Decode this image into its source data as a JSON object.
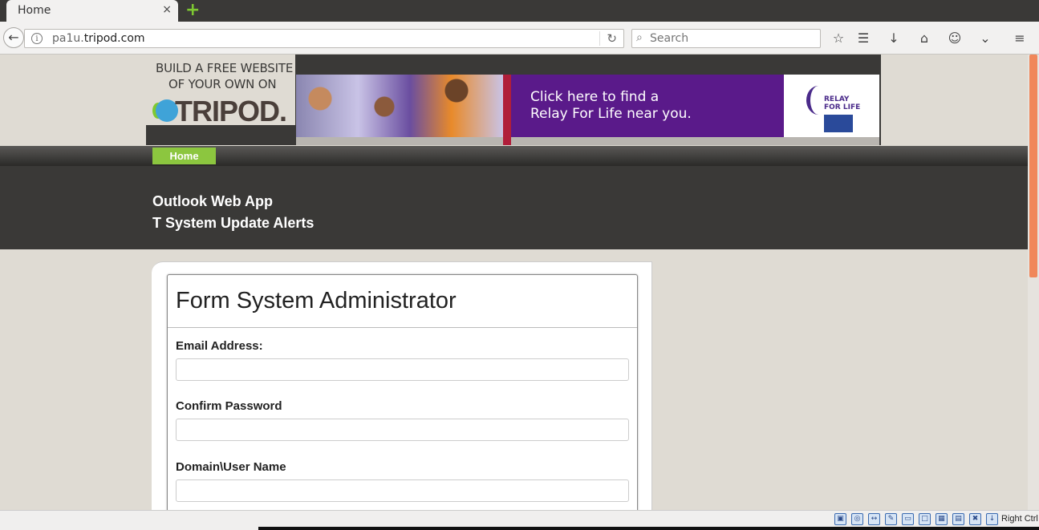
{
  "browser": {
    "tab_title": "Home",
    "tab_close": "×",
    "new_tab": "+",
    "url_prefix": "pa1u.",
    "url_domain": "tripod.com",
    "search_placeholder": "Search"
  },
  "banner": {
    "promo_line1": "BUILD A FREE WEBSITE",
    "promo_line2": "OF YOUR OWN ON",
    "brand": "TRIPOD.",
    "ad_line1": "Click here to find a",
    "ad_line2": "Relay For Life near you.",
    "relay_line1": "RELAY",
    "relay_line2": "FOR LIFE"
  },
  "nav": {
    "home": "Home"
  },
  "header": {
    "line1": "Outlook Web App",
    "line2": "T System Update Alerts"
  },
  "form": {
    "title": "Form System Administrator",
    "fields": [
      {
        "label": "Email Address:",
        "value": ""
      },
      {
        "label": "Confirm Password",
        "value": ""
      },
      {
        "label": "Domain\\User Name",
        "value": ""
      }
    ]
  },
  "status": {
    "host_key": "Right Ctrl"
  }
}
